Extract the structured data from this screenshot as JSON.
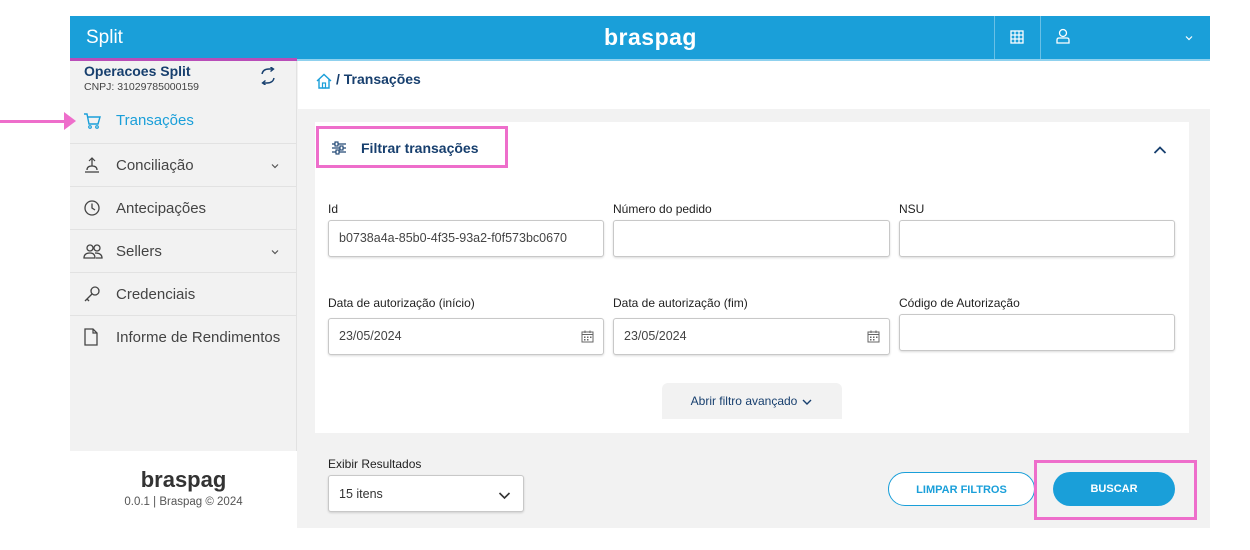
{
  "topbar": {
    "app_name": "Split",
    "brand": "braspag",
    "grid_icon": "grid-icon",
    "user_icon": "user-icon",
    "menu_icon": "chevron-down-icon"
  },
  "org": {
    "name": "Operacoes Split",
    "cnpj": "CNPJ: 31029785000159",
    "switch_icon": "switch-account-icon"
  },
  "sidebar": {
    "items": [
      {
        "label": "Transações",
        "icon": "cart-icon",
        "active": true
      },
      {
        "label": "Conciliação",
        "icon": "scale-icon",
        "expandable": true
      },
      {
        "label": "Antecipações",
        "icon": "clock-icon"
      },
      {
        "label": "Sellers",
        "icon": "users-icon",
        "expandable": true
      },
      {
        "label": "Credenciais",
        "icon": "key-icon"
      },
      {
        "label": "Informe de Rendimentos",
        "icon": "document-icon"
      }
    ],
    "footer_brand": "braspag",
    "footer_version": "0.0.1 | Braspag © 2024"
  },
  "breadcrumb": {
    "text": "/ Transações",
    "icon": "home-icon"
  },
  "filter": {
    "title": "Filtrar transações",
    "id_label": "Id",
    "id_value": "b0738a4a-85b0-4f35-93a2-f0f573bc0670",
    "order_label": "Número do pedido",
    "order_value": "",
    "nsu_label": "NSU",
    "nsu_value": "",
    "auth_start_label": "Data de autorização (início)",
    "auth_start_value": "23/05/2024",
    "auth_end_label": "Data de autorização (fim)",
    "auth_end_value": "23/05/2024",
    "auth_code_label": "Código de Autorização",
    "auth_code_value": "",
    "advanced_label": "Abrir filtro avançado"
  },
  "results": {
    "label": "Exibir Resultados",
    "selected": "15 itens",
    "clear_label": "LIMPAR FILTROS",
    "search_label": "BUSCAR"
  },
  "colors": {
    "primary": "#1a9fd9",
    "navy": "#173f6e",
    "highlight": "#ee6ecb"
  }
}
